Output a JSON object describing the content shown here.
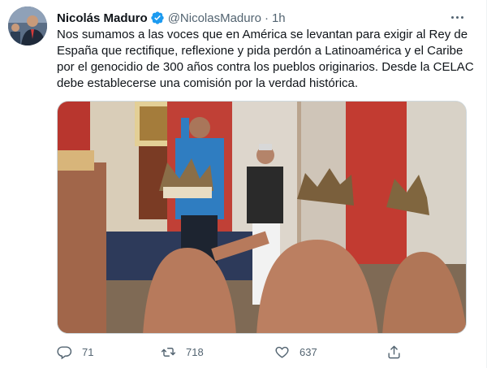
{
  "tweet": {
    "author_name": "Nicolás Maduro",
    "handle": "@NicolasMaduro",
    "separator": "·",
    "time": "1h",
    "text": "Nos sumamos a las voces que en América se levantan para exigir al Rey de España que rectifique, reflexione y pida perdón a Latinoamérica y el Caribe por el genocidio de 300 años contra los pueblos originarios. Desde la CELAC debe establecerse una comisión por la verdad histórica.",
    "verified_color": "#1d9bf0"
  },
  "actions": {
    "reply_count": "71",
    "retweet_count": "718",
    "like_count": "637"
  },
  "icons": {
    "verified": "verified-badge-icon",
    "more": "more-options-icon",
    "reply": "reply-icon",
    "retweet": "retweet-icon",
    "like": "heart-icon",
    "share": "share-icon"
  }
}
